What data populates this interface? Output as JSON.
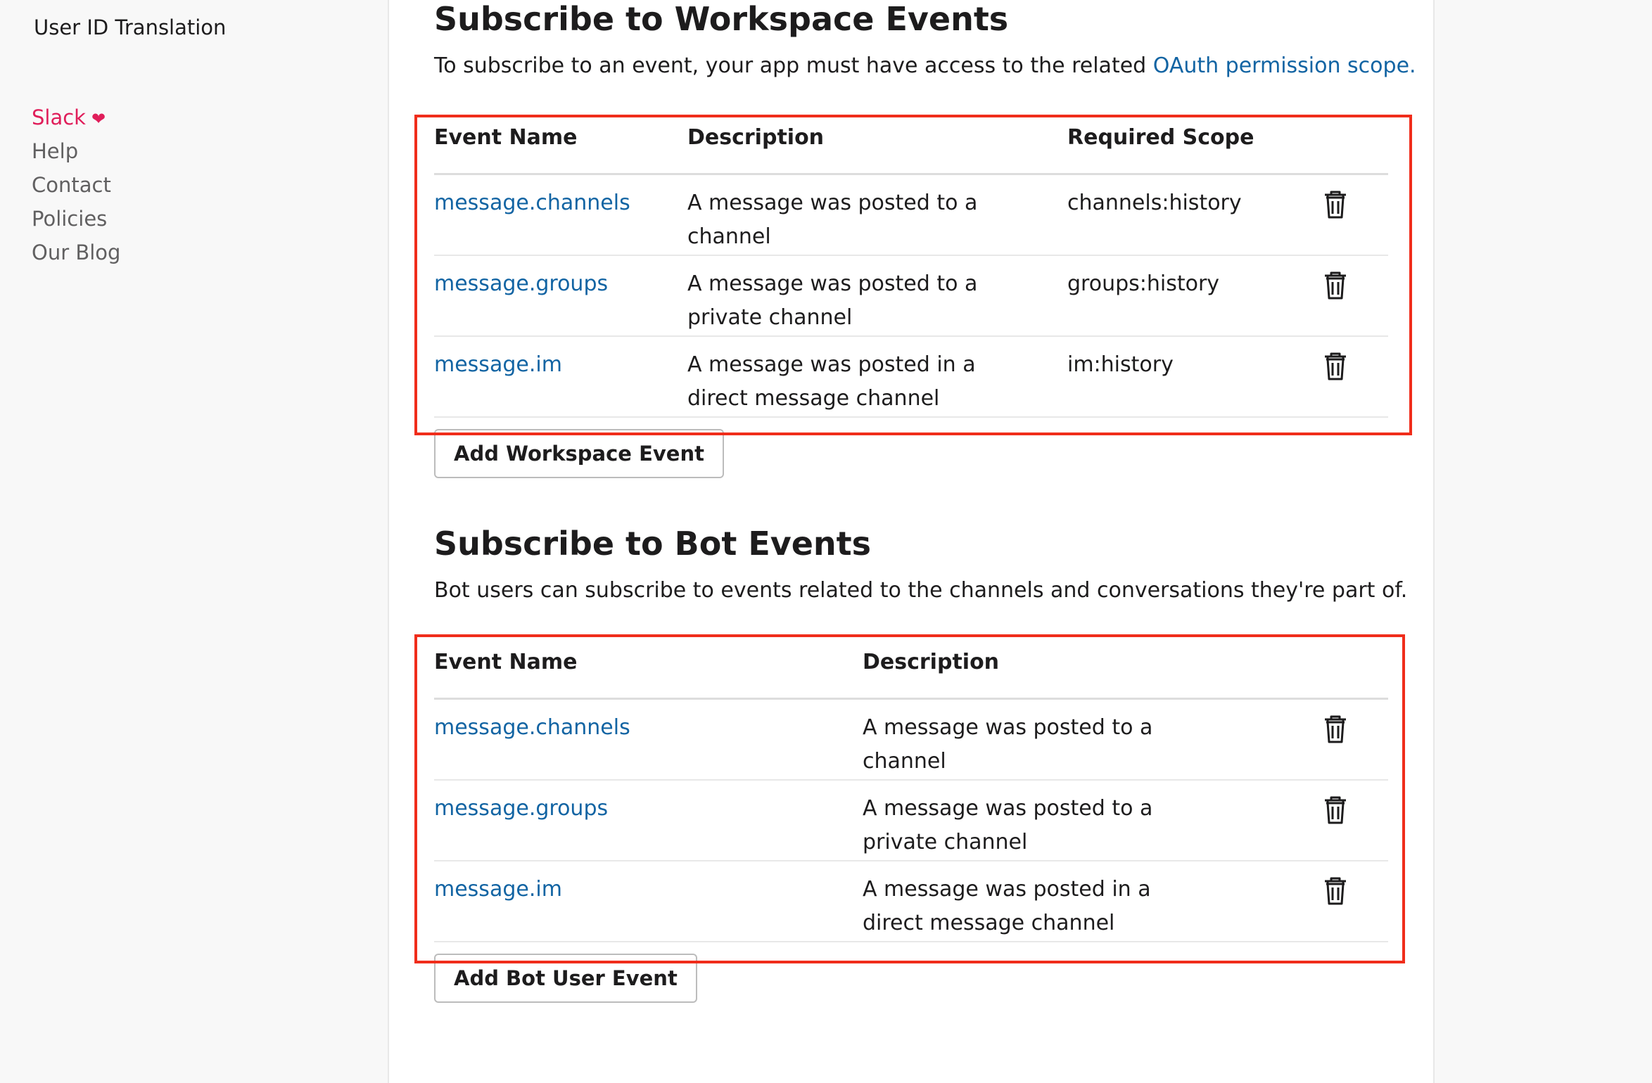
{
  "sidebar": {
    "title": "User ID Translation",
    "links": [
      {
        "label": "Slack",
        "icon": "heart-icon"
      },
      {
        "label": "Help"
      },
      {
        "label": "Contact"
      },
      {
        "label": "Policies"
      },
      {
        "label": "Our Blog"
      }
    ]
  },
  "workspace": {
    "heading": "Subscribe to Workspace Events",
    "intro_text": "To subscribe to an event, your app must have access to the related ",
    "intro_link": "OAuth permission scope.",
    "columns": [
      "Event Name",
      "Description",
      "Required Scope"
    ],
    "rows": [
      {
        "event": "message.channels",
        "description": "A message was posted to a channel",
        "scope": "channels:history"
      },
      {
        "event": "message.groups",
        "description": "A message was posted to a private channel",
        "scope": "groups:history"
      },
      {
        "event": "message.im",
        "description": "A message was posted in a direct message channel",
        "scope": "im:history"
      }
    ],
    "add_button": "Add Workspace Event"
  },
  "bot": {
    "heading": "Subscribe to Bot Events",
    "intro_text": "Bot users can subscribe to events related to the channels and conversations they're part of.",
    "columns": [
      "Event Name",
      "Description"
    ],
    "rows": [
      {
        "event": "message.channels",
        "description": "A message was posted to a channel"
      },
      {
        "event": "message.groups",
        "description": "A message was posted to a private channel"
      },
      {
        "event": "message.im",
        "description": "A message was posted in a direct message channel"
      }
    ],
    "add_button": "Add Bot User Event"
  },
  "colors": {
    "link": "#1264a3",
    "slack_accent": "#e01e5a",
    "highlight_box": "#f02d1b"
  }
}
